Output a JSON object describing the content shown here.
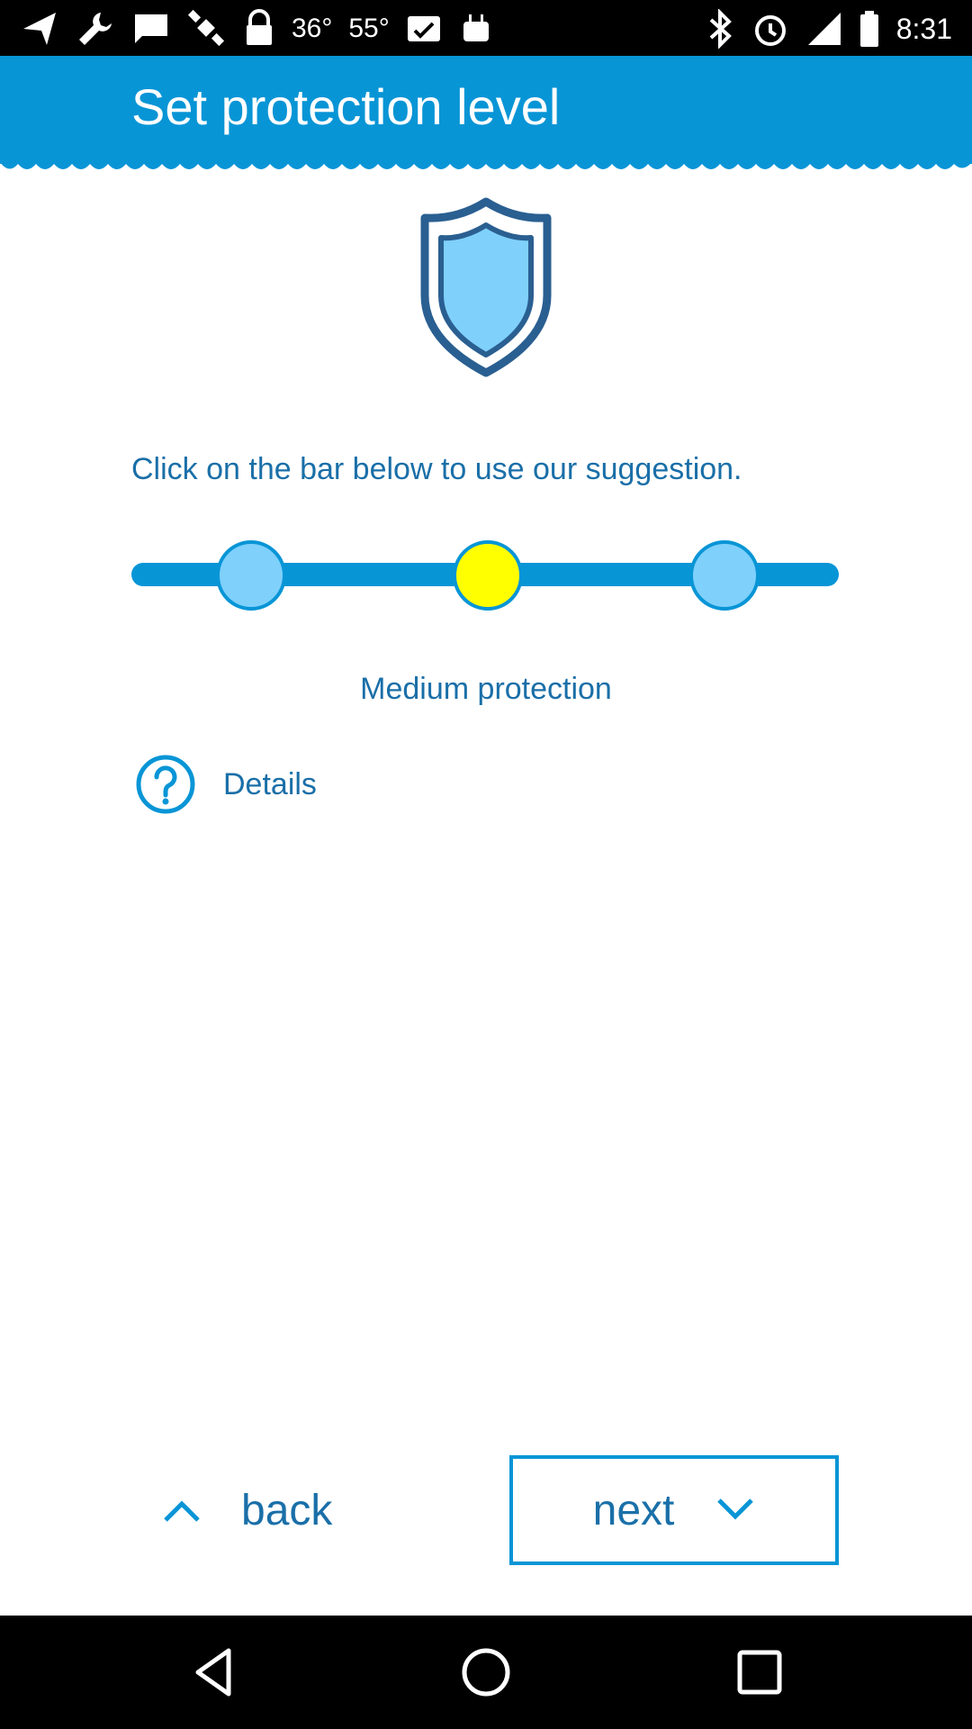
{
  "status_bar": {
    "temp1": "36°",
    "temp2": "55°",
    "time": "8:31",
    "left_icons": [
      "navigation-icon",
      "wrench-icon",
      "message-icon",
      "satellite-icon",
      "lock-icon"
    ],
    "right_icons": [
      "bluetooth-icon",
      "alarm-icon",
      "signal-icon",
      "battery-icon"
    ]
  },
  "header": {
    "title": "Set protection level",
    "color": "#0895d6"
  },
  "instruction": "Click on the bar below to use our suggestion.",
  "slider": {
    "stops": [
      {
        "level": "low",
        "color": "#7fd0fb"
      },
      {
        "level": "medium",
        "color": "#ffff00"
      },
      {
        "level": "high",
        "color": "#7fd0fb"
      }
    ],
    "selected_index": 1
  },
  "level_label": "Medium protection",
  "details": {
    "label": "Details",
    "icon": "help-icon"
  },
  "buttons": {
    "back_label": "back",
    "next_label": "next"
  },
  "nav_bar": {
    "icons": [
      "back-nav-icon",
      "home-nav-icon",
      "recents-nav-icon"
    ]
  },
  "colors": {
    "accent": "#0895d6",
    "text": "#1a6fa8",
    "shield_fill": "#7fd0fb",
    "shield_outline": "#2a5f91"
  }
}
